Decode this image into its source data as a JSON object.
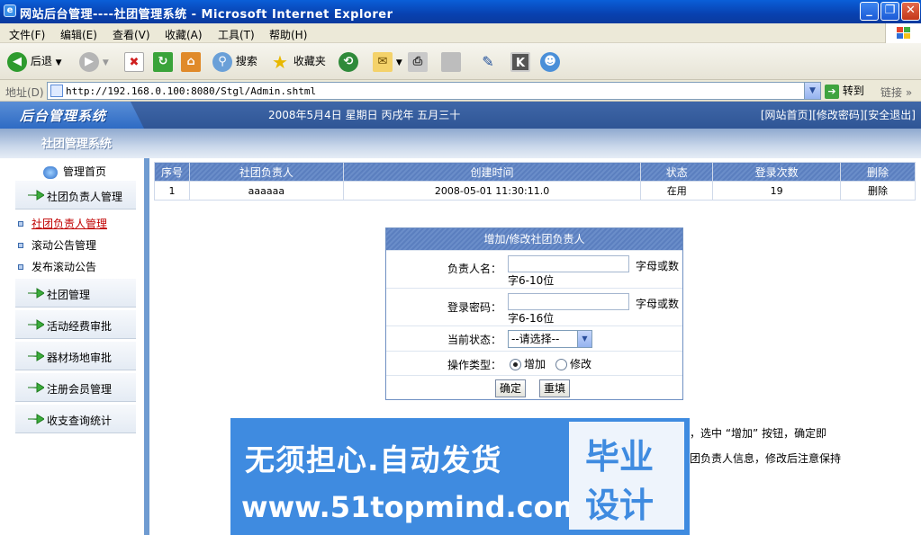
{
  "window": {
    "title": "网站后台管理----社团管理系统 - Microsoft Internet Explorer",
    "controls": [
      "_",
      "❐",
      "✕"
    ]
  },
  "menubar": [
    "文件(F)",
    "编辑(E)",
    "查看(V)",
    "收藏(A)",
    "工具(T)",
    "帮助(H)"
  ],
  "toolbar": {
    "back": "后退",
    "search": "搜索",
    "favorites": "收藏夹"
  },
  "address": {
    "label": "地址(D)",
    "url": "http://192.168.0.100:8080/Stgl/Admin.shtml",
    "go": "转到",
    "links": "链接"
  },
  "header": {
    "logo": "后台管理系统",
    "date": "2008年5月4日  星期日  丙戌年  五月三十",
    "links": [
      "[网站首页]",
      "[修改密码]",
      "[安全退出]"
    ],
    "subtitle": "社团管理系统"
  },
  "sidebar": {
    "home": "管理首页",
    "sections": [
      {
        "label": "社团负责人管理"
      },
      {
        "label": "社团管理"
      },
      {
        "label": "活动经费审批"
      },
      {
        "label": "器材场地审批"
      },
      {
        "label": "注册会员管理"
      },
      {
        "label": "收支查询统计"
      }
    ],
    "subitems": [
      {
        "label": "社团负责人管理",
        "active": true
      },
      {
        "label": "滚动公告管理",
        "active": false
      },
      {
        "label": "发布滚动公告",
        "active": false
      }
    ]
  },
  "table": {
    "headers": [
      "序号",
      "社团负责人",
      "创建时间",
      "状态",
      "登录次数",
      "删除"
    ],
    "rows": [
      [
        "1",
        "aaaaaa",
        "2008-05-01 11:30:11.0",
        "在用",
        "19",
        "删除"
      ]
    ]
  },
  "form": {
    "title": "增加/修改社团负责人",
    "name_label": "负责人名：",
    "name_hint_1": "字母或数",
    "name_hint_2": "字6-10位",
    "pwd_label": "登录密码：",
    "pwd_hint_1": "字母或数",
    "pwd_hint_2": "字6-16位",
    "status_label": "当前状态：",
    "status_value": "--请选择--",
    "op_label": "操作类型：",
    "op_add": "增加",
    "op_edit": "修改",
    "op_selected": "增加",
    "submit": "确定",
    "reset": "重填"
  },
  "notes": [
    "，选中 “增加” 按钮，确定即",
    "团负责人信息，修改后注意保持"
  ],
  "watermark": {
    "line1": "无须担心.自动发货",
    "line2": "www.51topmind.com",
    "box1": "毕业",
    "box2": "设计"
  }
}
